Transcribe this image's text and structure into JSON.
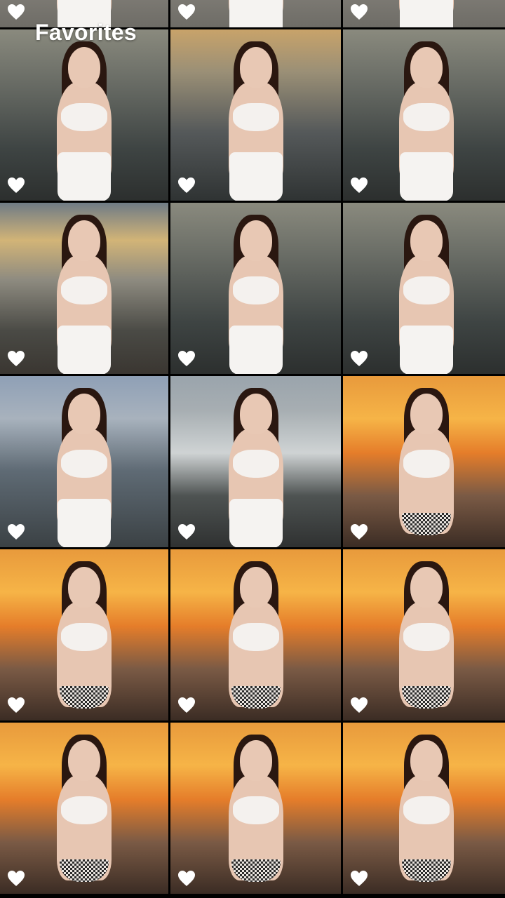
{
  "header": {
    "title": "Favorites"
  },
  "icons": {
    "favorite": "heart-icon"
  },
  "colors": {
    "heart": "#ffffff",
    "background": "#000000"
  },
  "photos": [
    {
      "scene": "beach-day",
      "favorited": true
    },
    {
      "scene": "beach-day",
      "favorited": true
    },
    {
      "scene": "beach-day",
      "favorited": true
    },
    {
      "scene": "ocean-waves",
      "favorited": true
    },
    {
      "scene": "ocean-sunset-glow",
      "favorited": true
    },
    {
      "scene": "ocean-waves",
      "favorited": true
    },
    {
      "scene": "sun-low-shore",
      "favorited": true
    },
    {
      "scene": "ocean-waves",
      "favorited": true
    },
    {
      "scene": "ocean-waves",
      "favorited": true
    },
    {
      "scene": "blue-sky-shore",
      "favorited": true
    },
    {
      "scene": "wave-splash",
      "favorited": true
    },
    {
      "scene": "orange-sunset",
      "favorited": true
    },
    {
      "scene": "orange-sunset",
      "favorited": true
    },
    {
      "scene": "orange-sunset",
      "favorited": true
    },
    {
      "scene": "orange-sunset",
      "favorited": true
    },
    {
      "scene": "orange-sunset",
      "favorited": true
    },
    {
      "scene": "orange-sunset",
      "favorited": true
    },
    {
      "scene": "orange-sunset",
      "favorited": true
    }
  ]
}
